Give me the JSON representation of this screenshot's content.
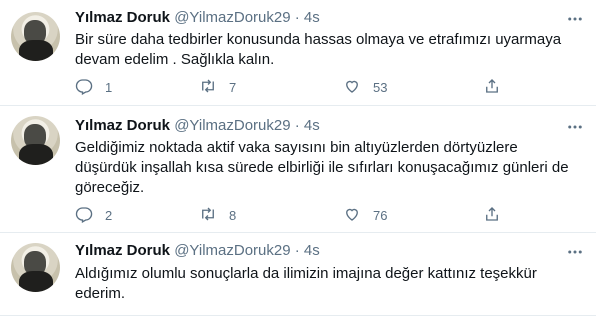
{
  "tweets": [
    {
      "name": "Yılmaz Doruk",
      "handle": "@YilmazDoruk29",
      "dot": "·",
      "time": "4s",
      "text": "Bir süre daha tedbirler konusunda hassas olmaya ve etrafımızı uyarmaya devam edelim . Sağlıkla kalın.",
      "replies": "1",
      "retweets": "7",
      "likes": "53"
    },
    {
      "name": "Yılmaz Doruk",
      "handle": "@YilmazDoruk29",
      "dot": "·",
      "time": "4s",
      "text": "Geldiğimiz noktada aktif vaka sayısını bin altıyüzlerden dörtyüzlere düşürdük inşallah kısa sürede elbirliği ile sıfırları konuşacağımız günleri de göreceğiz.",
      "replies": "2",
      "retweets": "8",
      "likes": "76"
    },
    {
      "name": "Yılmaz Doruk",
      "handle": "@YilmazDoruk29",
      "dot": "·",
      "time": "4s",
      "text": "Aldığımız olumlu sonuçlarla da ilimizin imajına değer kattınız teşekkür ederim."
    }
  ],
  "icons": {
    "reply": "reply-icon",
    "retweet": "retweet-icon",
    "like": "heart-icon",
    "share": "share-icon",
    "more": "more-icon"
  },
  "colors": {
    "text": "#0f1419",
    "secondary": "#5b7083",
    "divider": "#e6ecf0"
  }
}
